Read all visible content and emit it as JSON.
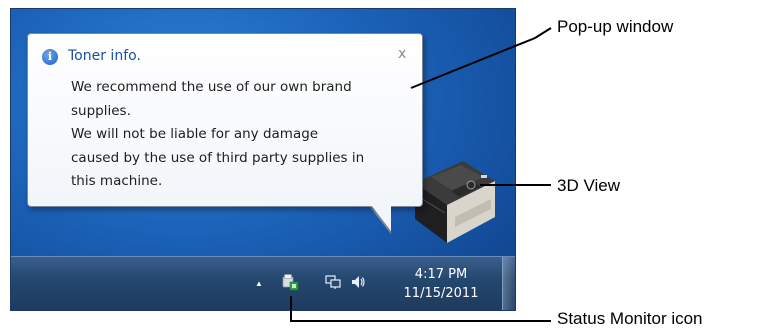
{
  "popup": {
    "icon": "info-icon",
    "title": "Toner info.",
    "close_glyph": "x",
    "lines": [
      "We recommend the use of our own brand",
      "supplies.",
      "We will not be liable for any damage",
      "caused by the use of third party supplies in",
      "this machine."
    ]
  },
  "taskbar": {
    "clock_time": "4:17 PM",
    "clock_date": "11/15/2011",
    "tray_icons": [
      "show-hidden-icons-arrow",
      "status-monitor-icon",
      "network-icon",
      "volume-icon"
    ]
  },
  "annotations": {
    "popup_window": "Pop-up window",
    "view_3d": "3D View",
    "status_monitor_icon": "Status Monitor icon"
  },
  "colors": {
    "desktop_blue": "#1b62b8",
    "taskbar": "#25486f",
    "popup_title": "#1b4fa3"
  }
}
